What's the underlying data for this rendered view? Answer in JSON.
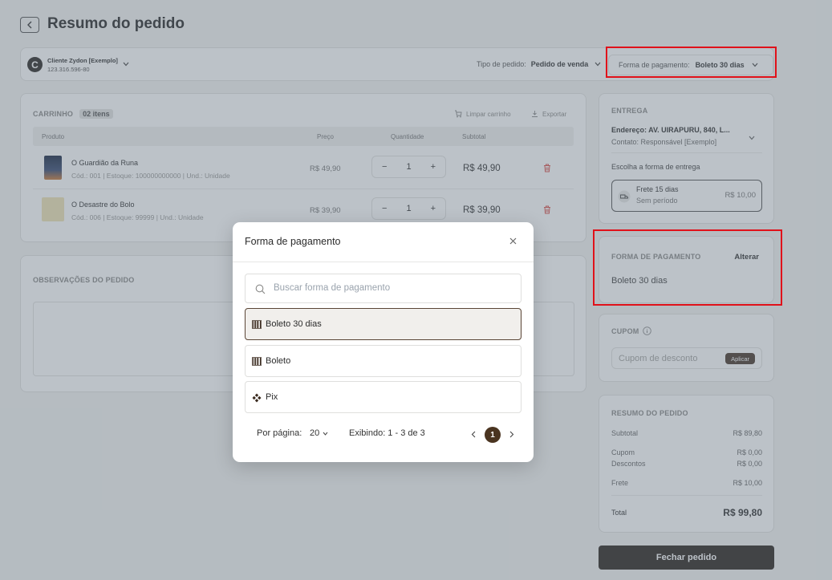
{
  "header": {
    "back_icon": "chevron-left",
    "title": "Resumo do pedido"
  },
  "client": {
    "initial": "C",
    "name": "Cliente Zydon [Exemplo]",
    "document": "123.316.596-80",
    "order_type_label": "Tipo de pedido:",
    "order_type_value": "Pedido de venda",
    "payment_label": "Forma de pagamento:",
    "payment_value": "Boleto 30 dias"
  },
  "cart": {
    "title": "CARRINHO",
    "count_badge": "02 itens",
    "clear_label": "Limpar carrinho",
    "export_label": "Exportar",
    "columns": {
      "product": "Produto",
      "price": "Preço",
      "quantity": "Quantidade",
      "subtotal": "Subtotal"
    },
    "items": [
      {
        "name": "O Guardião da Runa",
        "meta": "Cód.: 001 | Estoque: 100000000000 | Und.: Unidade",
        "price": "R$ 49,90",
        "qty": "1",
        "subtotal": "R$ 49,90"
      },
      {
        "name": "O Desastre do Bolo",
        "meta": "Cód.: 006 | Estoque: 99999 | Und.: Unidade",
        "price": "R$ 39,90",
        "qty": "1",
        "subtotal": "R$ 39,90"
      }
    ],
    "minus": "−",
    "plus": "+"
  },
  "observations": {
    "title": "OBSERVAÇÕES DO PEDIDO"
  },
  "delivery": {
    "title": "ENTREGA",
    "address": "Endereço: AV. UIRAPURU, 840, L...",
    "contact": "Contato: Responsável [Exemplo]",
    "choose_label": "Escolha a forma de entrega",
    "shipping_name": "Frete 15 dias",
    "shipping_period": "Sem período",
    "shipping_price": "R$ 10,00"
  },
  "payment": {
    "title": "FORMA DE PAGAMENTO",
    "change_label": "Alterar",
    "value": "Boleto 30 dias"
  },
  "coupon": {
    "title": "CUPOM",
    "placeholder": "Cupom de desconto",
    "apply_label": "Aplicar"
  },
  "summary": {
    "title": "RESUMO DO PEDIDO",
    "subtotal_label": "Subtotal",
    "subtotal_value": "R$ 89,80",
    "coupon_label": "Cupom",
    "coupon_value": "R$ 0,00",
    "discount_label": "Descontos",
    "discount_value": "R$ 0,00",
    "shipping_label": "Frete",
    "shipping_value": "R$ 10,00",
    "total_label": "Total",
    "total_value": "R$ 99,80"
  },
  "close_order_label": "Fechar pedido",
  "modal": {
    "title": "Forma de pagamento",
    "search_placeholder": "Buscar forma de pagamento",
    "options": [
      {
        "label": "Boleto 30 dias",
        "icon": "barcode-icon",
        "selected": true
      },
      {
        "label": "Boleto",
        "icon": "barcode-icon",
        "selected": false
      },
      {
        "label": "Pix",
        "icon": "pix-icon",
        "selected": false
      }
    ],
    "per_page_label": "Por página:",
    "per_page_value": "20",
    "showing": "Exibindo: 1 - 3 de 3",
    "current_page": "1"
  },
  "colors": {
    "accent": "#2e2620",
    "highlight": "#e0111a",
    "danger": "#d9534f"
  }
}
